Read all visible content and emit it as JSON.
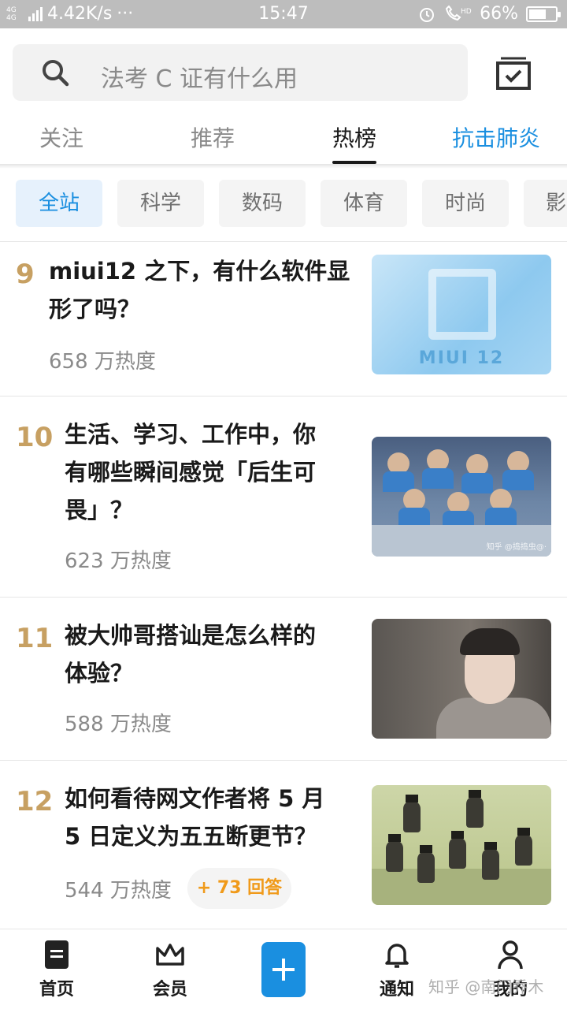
{
  "status_bar": {
    "network_type": "4G 4G",
    "network_speed": "4.42K/s",
    "more_dots": "···",
    "time": "15:47",
    "battery_percent": "66%",
    "battery_level": 0.66
  },
  "search": {
    "placeholder": "法考 C 证有什么用",
    "icon": "search-icon"
  },
  "tabs": [
    {
      "label": "关注"
    },
    {
      "label": "推荐"
    },
    {
      "label": "热榜"
    },
    {
      "label": "抗击肺炎"
    }
  ],
  "categories": [
    {
      "label": "全站"
    },
    {
      "label": "科学"
    },
    {
      "label": "数码"
    },
    {
      "label": "体育"
    },
    {
      "label": "时尚"
    },
    {
      "label": "影"
    }
  ],
  "hot_list": [
    {
      "rank": "9",
      "title_lines": [
        "miui12 之下，有什么软件显",
        "形了吗？"
      ],
      "heat": "658 万热度",
      "thumb_text": "MIUI 12"
    },
    {
      "rank": "10",
      "title_lines": [
        "生活、学习、工作中，你",
        "有哪些瞬间感觉「后生可",
        "畏」？"
      ],
      "heat": "623 万热度",
      "thumb_text": "知乎 @捣捣虫@·"
    },
    {
      "rank": "11",
      "title_lines": [
        "被大帅哥搭讪是怎么样的",
        "体验？"
      ],
      "heat": "588 万热度"
    },
    {
      "rank": "12",
      "title_lines": [
        "如何看待网文作者将 5 月",
        "5 日定义为五五断更节？"
      ],
      "heat": "544 万热度",
      "answers": "+ 73 回答"
    }
  ],
  "bottom_nav": {
    "home": "首页",
    "member": "会员",
    "notify": "通知",
    "mine": "我的"
  },
  "watermark": "知乎 @南门乔木",
  "colors": {
    "accent": "#1a8fe0",
    "rank": "#c7a062",
    "answer_badge": "#f09a1a"
  }
}
